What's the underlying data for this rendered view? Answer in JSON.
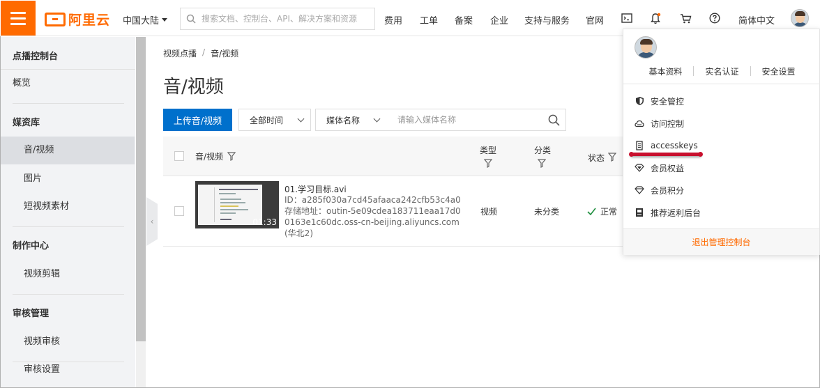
{
  "header": {
    "logo_text": "阿里云",
    "region": "中国大陆",
    "search_placeholder": "搜索文档、控制台、API、解决方案和资源",
    "nav": [
      "费用",
      "工单",
      "备案",
      "企业",
      "支持与服务",
      "官网"
    ],
    "language": "简体中文",
    "accent": "#ff6a00"
  },
  "sidebar": {
    "title": "点播控制台",
    "overview": "概览",
    "groups": [
      {
        "label": "媒资库",
        "items": [
          "音/视频",
          "图片",
          "短视频素材"
        ]
      },
      {
        "label": "制作中心",
        "items": [
          "视频剪辑"
        ]
      },
      {
        "label": "审核管理",
        "items": [
          "视频审核",
          "审核设置"
        ]
      }
    ],
    "active_item": "音/视频"
  },
  "main": {
    "breadcrumb": [
      "视频点播",
      "音/视频"
    ],
    "title": "音/视频",
    "upload_button": "上传音/视频",
    "time_filter": "全部时间",
    "field_filter": "媒体名称",
    "name_placeholder": "请输入媒体名称",
    "primary_color": "#0070cc",
    "table": {
      "columns": [
        "音/视频",
        "类型",
        "分类",
        "状态"
      ],
      "rows": [
        {
          "name": "01.学习目标.avi",
          "id": "ID：a285f030a7cd45afaaca242cfb53c4a0",
          "storage": "存储地址：outin-5e09cdea183711eaa17d00163e1c60dc.oss-cn-beijing.aliyuncs.com(华北2)",
          "duration": "01:33",
          "type": "视频",
          "category": "未分类",
          "status": "正常"
        }
      ]
    }
  },
  "dropdown": {
    "links": [
      "基本资料",
      "实名认证",
      "安全设置"
    ],
    "items": [
      {
        "label": "安全管控",
        "icon": "shield-icon"
      },
      {
        "label": "访问控制",
        "icon": "cloud-icon"
      },
      {
        "label": "accesskeys",
        "icon": "key-icon"
      },
      {
        "label": "会员权益",
        "icon": "diamond-icon"
      },
      {
        "label": "会员积分",
        "icon": "diamond-outline-icon"
      },
      {
        "label": "推荐返利后台",
        "icon": "document-icon"
      }
    ],
    "logout": "退出管理控制台",
    "highlight_color": "#c8102e"
  }
}
